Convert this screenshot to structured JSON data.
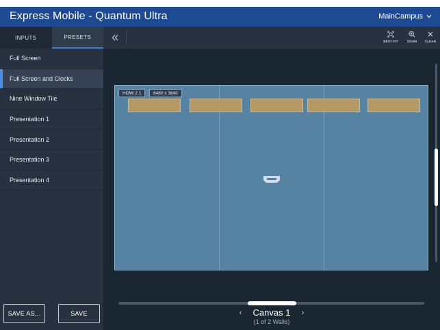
{
  "app": {
    "title": "Express Mobile - Quantum Ultra",
    "campus": "MainCampus"
  },
  "sidebar": {
    "tabs": [
      {
        "label": "INPUTS"
      },
      {
        "label": "PRESETS"
      }
    ],
    "presets": [
      {
        "label": "Full Screen"
      },
      {
        "label": "Full Screen and Clocks"
      },
      {
        "label": "Nine Window Tile"
      },
      {
        "label": "Presentation 1"
      },
      {
        "label": "Presentation 2"
      },
      {
        "label": "Presentation 3"
      },
      {
        "label": "Presentation 4"
      }
    ],
    "active_preset": "Full Screen and Clocks",
    "save_as_label": "SAVE AS...",
    "save_label": "SAVE"
  },
  "toolbar": {
    "best_fit_label": "BEST FIT",
    "zoom_label": "ZOOM",
    "clear_label": "CLEAR"
  },
  "wall": {
    "input_label": "HDMI 2.1",
    "resolution_label": "6480 x 3840",
    "window_count": 5
  },
  "canvas": {
    "name": "Canvas 1",
    "subtitle": "(1 of 2 Walls)"
  },
  "colors": {
    "header": "#1d4a93",
    "accent": "#4b8ee8",
    "wall": "#5683a2",
    "window": "#b69a66"
  }
}
